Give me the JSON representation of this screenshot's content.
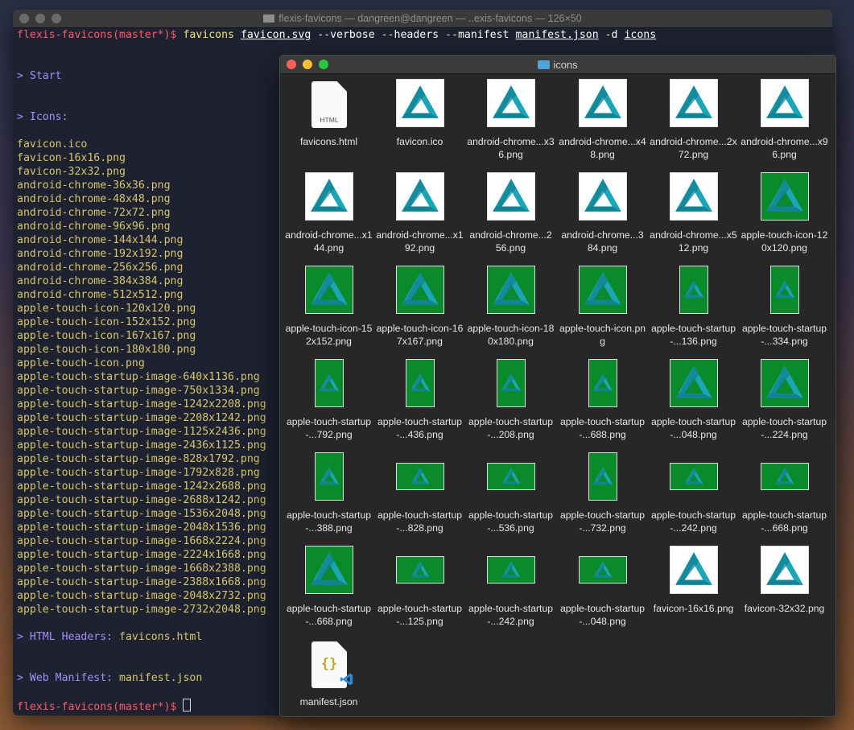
{
  "terminal": {
    "title": "flexis-favicons — dangreen@dangreen — ..exis-favicons — 126×50",
    "prompt": "flexis-favicons(master*)$",
    "command": "favicons",
    "args": [
      {
        "text": "favicon.svg",
        "u": true
      },
      {
        "text": "--verbose",
        "u": false
      },
      {
        "text": "--headers",
        "u": false
      },
      {
        "text": "--manifest",
        "u": false
      },
      {
        "text": "manifest.json",
        "u": true
      },
      {
        "text": "-d",
        "u": false
      },
      {
        "text": "icons",
        "u": true
      }
    ],
    "start_label": "> Start",
    "icons_label": "> Icons:",
    "files": [
      "favicon.ico",
      "favicon-16x16.png",
      "favicon-32x32.png",
      "android-chrome-36x36.png",
      "android-chrome-48x48.png",
      "android-chrome-72x72.png",
      "android-chrome-96x96.png",
      "android-chrome-144x144.png",
      "android-chrome-192x192.png",
      "android-chrome-256x256.png",
      "android-chrome-384x384.png",
      "android-chrome-512x512.png",
      "apple-touch-icon-120x120.png",
      "apple-touch-icon-152x152.png",
      "apple-touch-icon-167x167.png",
      "apple-touch-icon-180x180.png",
      "apple-touch-icon.png",
      "apple-touch-startup-image-640x1136.png",
      "apple-touch-startup-image-750x1334.png",
      "apple-touch-startup-image-1242x2208.png",
      "apple-touch-startup-image-2208x1242.png",
      "apple-touch-startup-image-1125x2436.png",
      "apple-touch-startup-image-2436x1125.png",
      "apple-touch-startup-image-828x1792.png",
      "apple-touch-startup-image-1792x828.png",
      "apple-touch-startup-image-1242x2688.png",
      "apple-touch-startup-image-2688x1242.png",
      "apple-touch-startup-image-1536x2048.png",
      "apple-touch-startup-image-2048x1536.png",
      "apple-touch-startup-image-1668x2224.png",
      "apple-touch-startup-image-2224x1668.png",
      "apple-touch-startup-image-1668x2388.png",
      "apple-touch-startup-image-2388x1668.png",
      "apple-touch-startup-image-2048x2732.png",
      "apple-touch-startup-image-2732x2048.png"
    ],
    "html_headers_label": "> HTML Headers:",
    "html_headers_file": "favicons.html",
    "manifest_label": "> Web Manifest:",
    "manifest_file": "manifest.json"
  },
  "finder": {
    "title": "icons",
    "items": [
      {
        "kind": "html",
        "label": "favicons.html",
        "doc_text": "HTML"
      },
      {
        "kind": "icon",
        "bg": "white",
        "shape": "sq",
        "label": "favicon.ico"
      },
      {
        "kind": "icon",
        "bg": "white",
        "shape": "sq",
        "label": "android-chrome...x36.png"
      },
      {
        "kind": "icon",
        "bg": "white",
        "shape": "sq",
        "label": "android-chrome...x48.png"
      },
      {
        "kind": "icon",
        "bg": "white",
        "shape": "sq",
        "label": "android-chrome...2x72.png"
      },
      {
        "kind": "icon",
        "bg": "white",
        "shape": "sq",
        "label": "android-chrome...x96.png"
      },
      {
        "kind": "icon",
        "bg": "white",
        "shape": "sq",
        "label": "android-chrome...x144.png"
      },
      {
        "kind": "icon",
        "bg": "white",
        "shape": "sq",
        "label": "android-chrome...x192.png"
      },
      {
        "kind": "icon",
        "bg": "white",
        "shape": "sq",
        "label": "android-chrome...256.png"
      },
      {
        "kind": "icon",
        "bg": "white",
        "shape": "sq",
        "label": "android-chrome...384.png"
      },
      {
        "kind": "icon",
        "bg": "white",
        "shape": "sq",
        "label": "android-chrome...x512.png"
      },
      {
        "kind": "icon",
        "bg": "green",
        "shape": "sq",
        "label": "apple-touch-icon-120x120.png"
      },
      {
        "kind": "icon",
        "bg": "green",
        "shape": "sq",
        "label": "apple-touch-icon-152x152.png"
      },
      {
        "kind": "icon",
        "bg": "green",
        "shape": "sq",
        "label": "apple-touch-icon-167x167.png"
      },
      {
        "kind": "icon",
        "bg": "green",
        "shape": "sq",
        "label": "apple-touch-icon-180x180.png"
      },
      {
        "kind": "icon",
        "bg": "green",
        "shape": "sq",
        "label": "apple-touch-icon.png"
      },
      {
        "kind": "icon",
        "bg": "green",
        "shape": "tall",
        "label": "apple-touch-startup-...136.png"
      },
      {
        "kind": "icon",
        "bg": "green",
        "shape": "tall",
        "label": "apple-touch-startup-...334.png"
      },
      {
        "kind": "icon",
        "bg": "green",
        "shape": "tall",
        "label": "apple-touch-startup-...792.png"
      },
      {
        "kind": "icon",
        "bg": "green",
        "shape": "tall",
        "label": "apple-touch-startup-...436.png"
      },
      {
        "kind": "icon",
        "bg": "green",
        "shape": "tall",
        "label": "apple-touch-startup-...208.png"
      },
      {
        "kind": "icon",
        "bg": "green",
        "shape": "tall",
        "label": "apple-touch-startup-...688.png"
      },
      {
        "kind": "icon",
        "bg": "green",
        "shape": "sq",
        "label": "apple-touch-startup-...048.png"
      },
      {
        "kind": "icon",
        "bg": "green",
        "shape": "sq",
        "label": "apple-touch-startup-...224.png"
      },
      {
        "kind": "icon",
        "bg": "green",
        "shape": "tall",
        "label": "apple-touch-startup-...388.png"
      },
      {
        "kind": "icon",
        "bg": "green",
        "shape": "wide",
        "label": "apple-touch-startup-...828.png"
      },
      {
        "kind": "icon",
        "bg": "green",
        "shape": "wide",
        "label": "apple-touch-startup-...536.png"
      },
      {
        "kind": "icon",
        "bg": "green",
        "shape": "tall",
        "label": "apple-touch-startup-...732.png"
      },
      {
        "kind": "icon",
        "bg": "green",
        "shape": "wide",
        "label": "apple-touch-startup-...242.png"
      },
      {
        "kind": "icon",
        "bg": "green",
        "shape": "wide",
        "label": "apple-touch-startup-...668.png"
      },
      {
        "kind": "icon",
        "bg": "green",
        "shape": "sq",
        "label": "apple-touch-startup-...668.png"
      },
      {
        "kind": "icon",
        "bg": "green",
        "shape": "wide",
        "label": "apple-touch-startup-...125.png"
      },
      {
        "kind": "icon",
        "bg": "green",
        "shape": "wide",
        "label": "apple-touch-startup-...242.png"
      },
      {
        "kind": "icon",
        "bg": "green",
        "shape": "wide",
        "label": "apple-touch-startup-...048.png"
      },
      {
        "kind": "icon",
        "bg": "white",
        "shape": "sq",
        "label": "favicon-16x16.png"
      },
      {
        "kind": "icon",
        "bg": "white",
        "shape": "sq",
        "label": "favicon-32x32.png"
      },
      {
        "kind": "json",
        "label": "manifest.json",
        "doc_text": "{}"
      }
    ]
  },
  "colors": {
    "prompt": "#ff5a6a",
    "section": "#a68bff",
    "filename": "#d6c56b",
    "icon_teal": "#1aa6b7",
    "icon_green": "#0a8a2a"
  }
}
